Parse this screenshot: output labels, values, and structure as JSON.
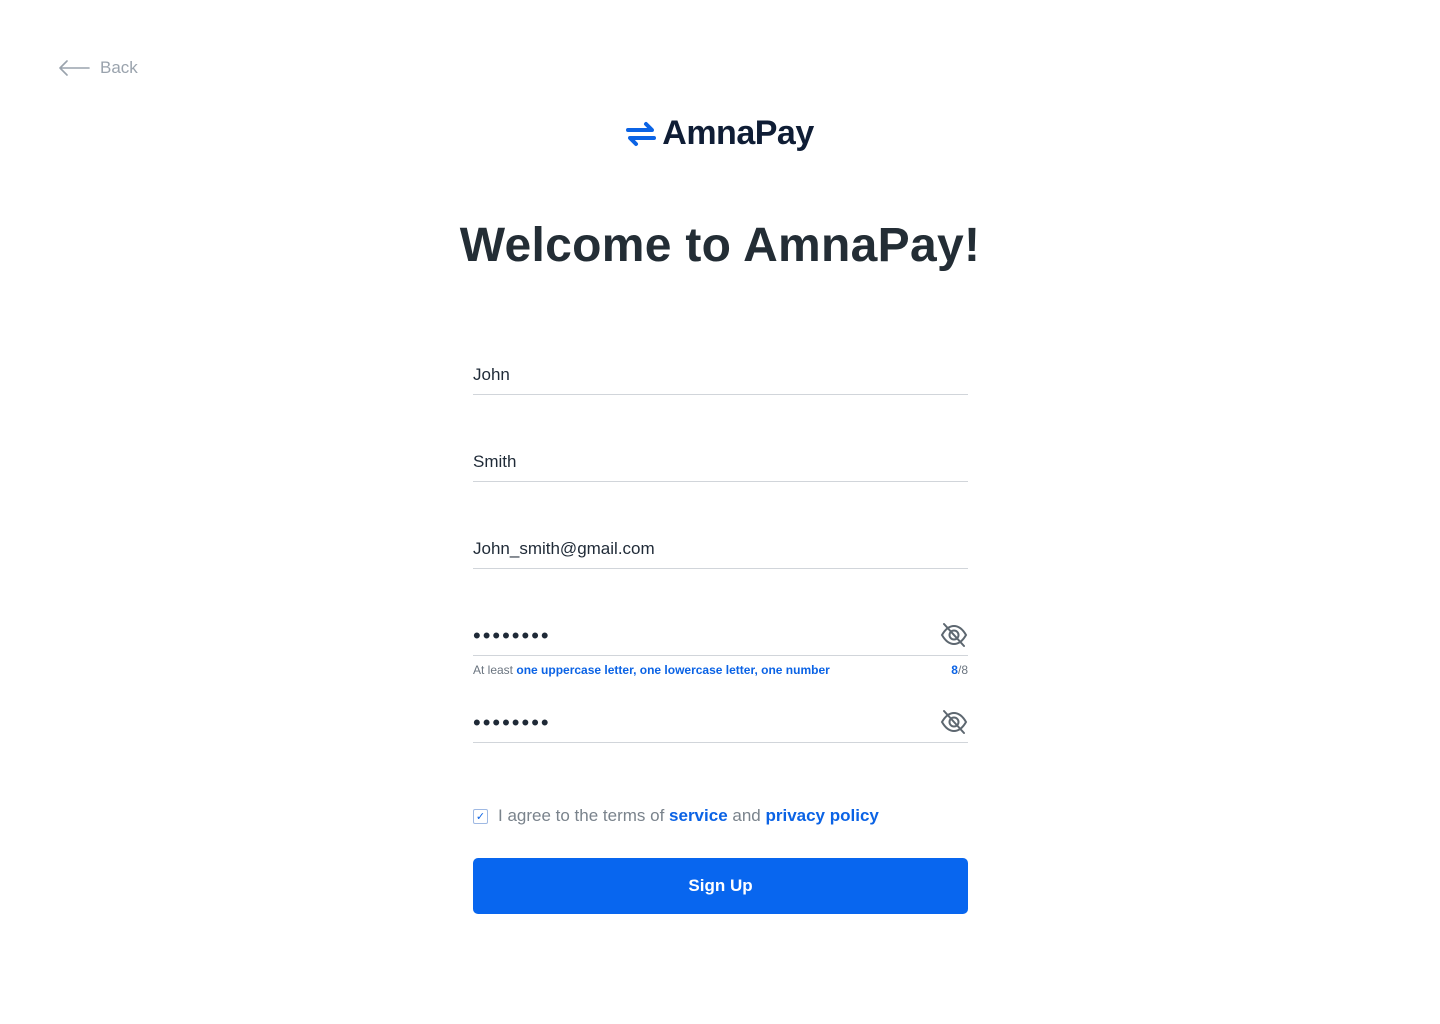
{
  "back": {
    "label": "Back"
  },
  "brand": {
    "name": "AmnaPay",
    "accent": "#0b63e5"
  },
  "heading": "Welcome to AmnaPay!",
  "form": {
    "first_name": "John",
    "last_name": "Smith",
    "email": "John_smith@gmail.com",
    "password": "••••••••",
    "password_confirm": "••••••••",
    "password_hint": {
      "prefix": "At least ",
      "requirements": "one uppercase letter, one lowercase letter, one number",
      "count_current": "8",
      "count_total": "/8"
    },
    "agree": {
      "checked": true,
      "text": "I agree to the terms of ",
      "service": "service",
      "and": " and ",
      "privacy": "privacy policy"
    },
    "submit_label": "Sign Up"
  },
  "colors": {
    "primary": "#0866ef",
    "heading": "#232d35",
    "muted": "#9aa3ad"
  }
}
